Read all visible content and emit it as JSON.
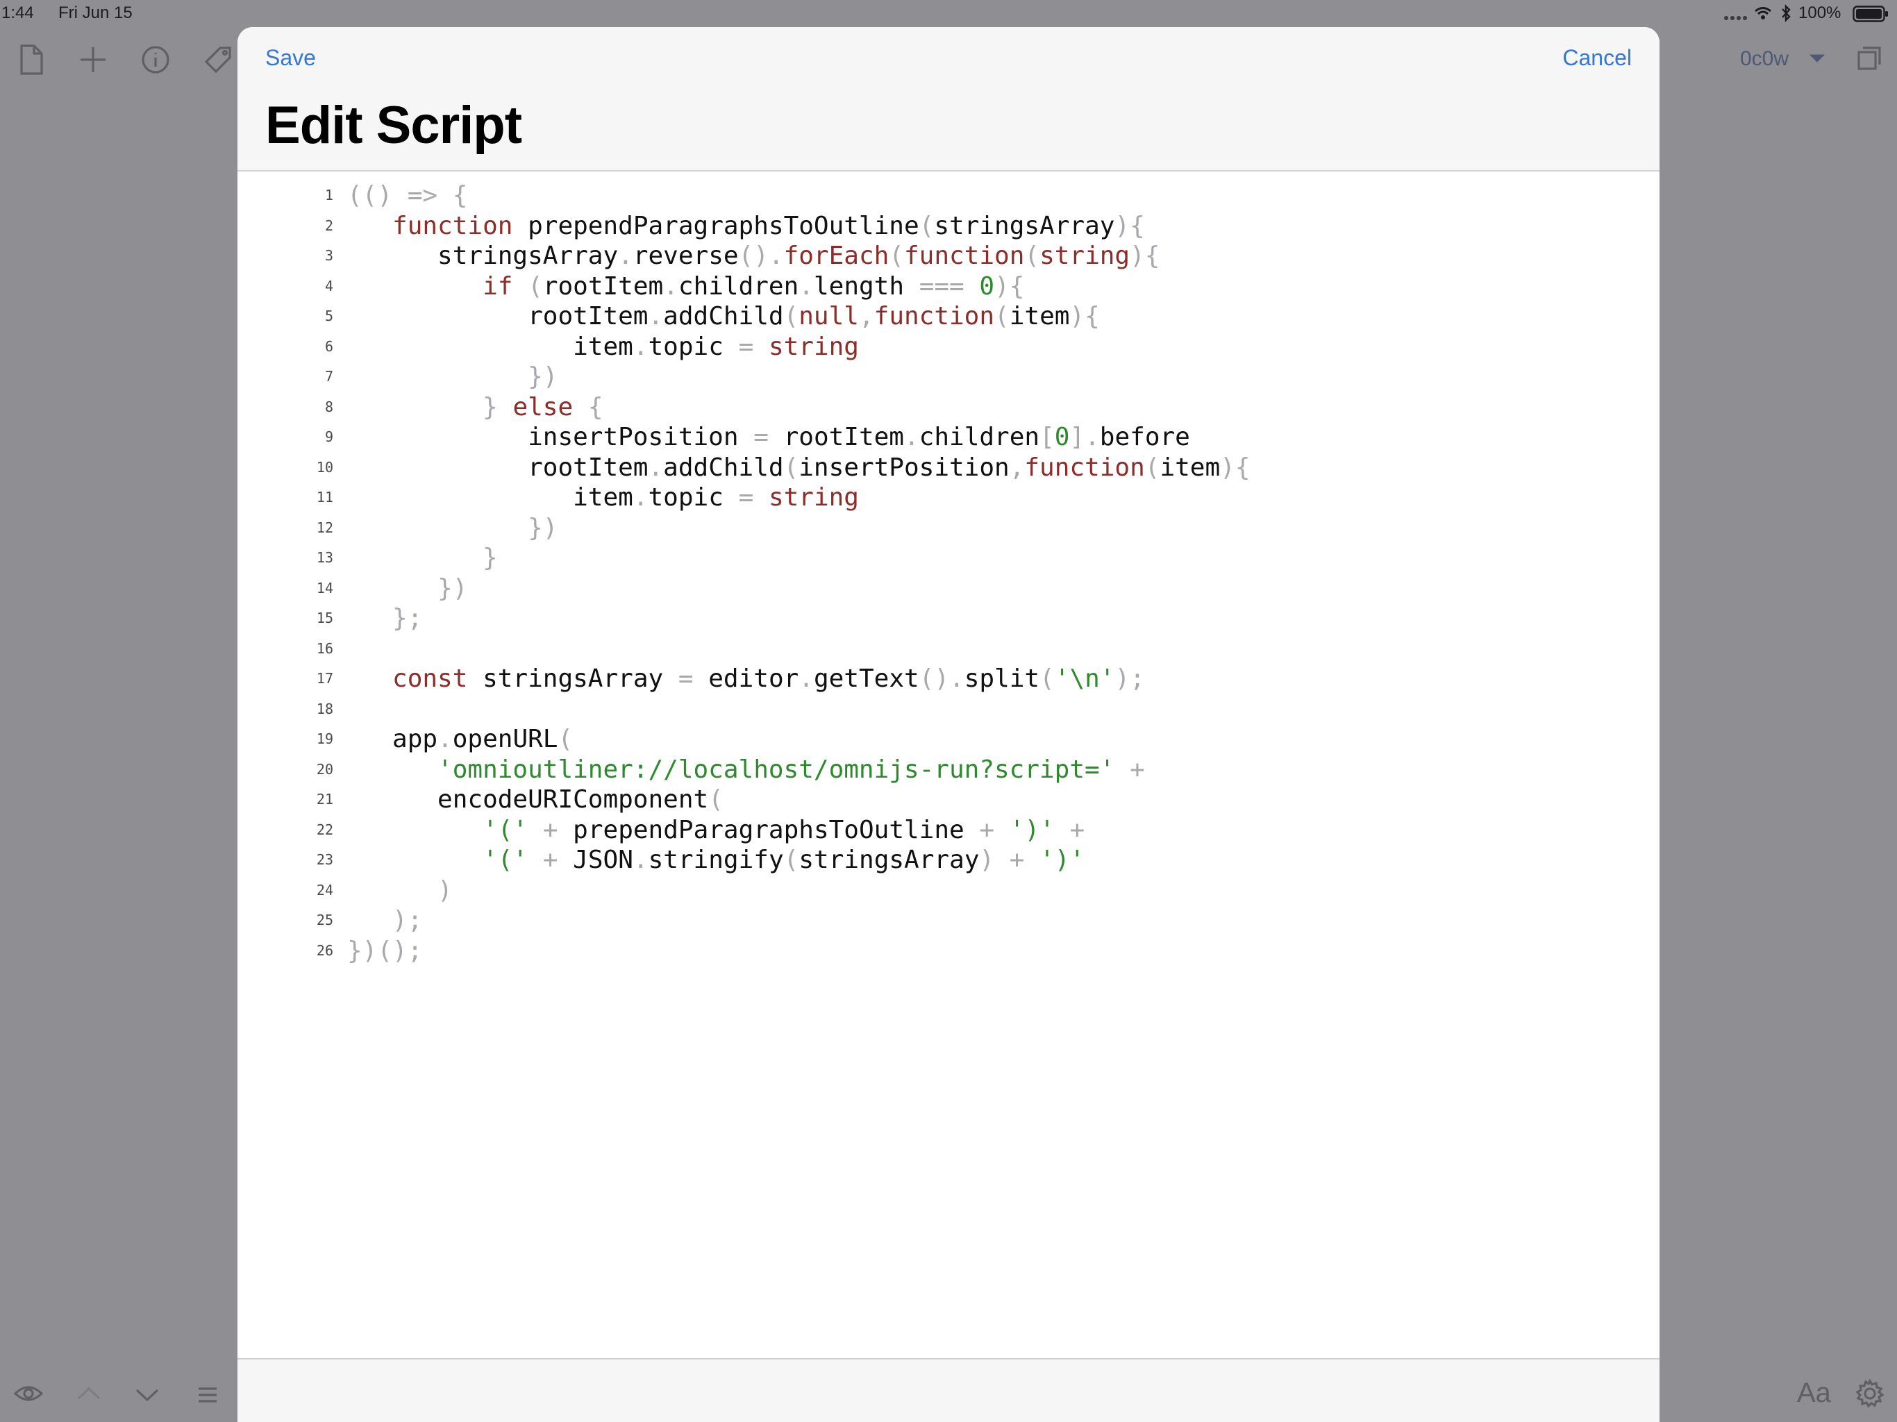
{
  "status_bar": {
    "time": "1:44",
    "date": "Fri Jun 15",
    "battery_percent": "100%",
    "signal_icon": "signal-dots-icon",
    "wifi_icon": "wifi-icon",
    "bluetooth_icon": "bluetooth-icon",
    "battery_icon": "battery-icon"
  },
  "background_toolbar": {
    "document_label": "0c0w",
    "icons": [
      "document-icon",
      "plus-icon",
      "info-icon",
      "tag-icon",
      "chevron-down-icon",
      "duplicate-icon"
    ]
  },
  "background_bottom_toolbar": {
    "font_label": "Aa",
    "icons": [
      "eye-icon",
      "chevron-up-icon",
      "chevron-down-icon",
      "list-icon",
      "gear-icon"
    ]
  },
  "modal": {
    "save_label": "Save",
    "cancel_label": "Cancel",
    "title": "Edit Script",
    "accent_color": "#3478d6"
  },
  "code": {
    "line_numbers": [
      "1",
      "2",
      "3",
      "4",
      "5",
      "6",
      "7",
      "8",
      "9",
      "10",
      "11",
      "12",
      "13",
      "14",
      "15",
      "16",
      "17",
      "18",
      "19",
      "20",
      "21",
      "22",
      "23",
      "24",
      "25",
      "26"
    ],
    "lines": [
      [
        [
          "p",
          "(() => {"
        ]
      ],
      [
        [
          "w",
          "   "
        ],
        [
          "k",
          "function"
        ],
        [
          "w",
          " "
        ],
        [
          "i",
          "prependParagraphsToOutline"
        ],
        [
          "p",
          "("
        ],
        [
          "i",
          "stringsArray"
        ],
        [
          "p",
          "){"
        ]
      ],
      [
        [
          "w",
          "      "
        ],
        [
          "i",
          "stringsArray"
        ],
        [
          "p",
          "."
        ],
        [
          "i",
          "reverse"
        ],
        [
          "p",
          "()."
        ],
        [
          "k",
          "forEach"
        ],
        [
          "p",
          "("
        ],
        [
          "k",
          "function"
        ],
        [
          "p",
          "("
        ],
        [
          "k",
          "string"
        ],
        [
          "p",
          "){"
        ]
      ],
      [
        [
          "w",
          "         "
        ],
        [
          "k",
          "if"
        ],
        [
          "w",
          " "
        ],
        [
          "p",
          "("
        ],
        [
          "i",
          "rootItem"
        ],
        [
          "p",
          "."
        ],
        [
          "i",
          "children"
        ],
        [
          "p",
          "."
        ],
        [
          "i",
          "length"
        ],
        [
          "w",
          " "
        ],
        [
          "p",
          "==="
        ],
        [
          "w",
          " "
        ],
        [
          "n",
          "0"
        ],
        [
          "p",
          "){"
        ]
      ],
      [
        [
          "w",
          "            "
        ],
        [
          "i",
          "rootItem"
        ],
        [
          "p",
          "."
        ],
        [
          "i",
          "addChild"
        ],
        [
          "p",
          "("
        ],
        [
          "k",
          "null"
        ],
        [
          "p",
          ","
        ],
        [
          "k",
          "function"
        ],
        [
          "p",
          "("
        ],
        [
          "i",
          "item"
        ],
        [
          "p",
          "){"
        ]
      ],
      [
        [
          "w",
          "               "
        ],
        [
          "i",
          "item"
        ],
        [
          "p",
          "."
        ],
        [
          "i",
          "topic"
        ],
        [
          "w",
          " "
        ],
        [
          "p",
          "="
        ],
        [
          "w",
          " "
        ],
        [
          "k",
          "string"
        ]
      ],
      [
        [
          "w",
          "            "
        ],
        [
          "p",
          "})"
        ]
      ],
      [
        [
          "w",
          "         "
        ],
        [
          "p",
          "}"
        ],
        [
          "w",
          " "
        ],
        [
          "k",
          "else"
        ],
        [
          "w",
          " "
        ],
        [
          "p",
          "{"
        ]
      ],
      [
        [
          "w",
          "            "
        ],
        [
          "i",
          "insertPosition"
        ],
        [
          "w",
          " "
        ],
        [
          "p",
          "="
        ],
        [
          "w",
          " "
        ],
        [
          "i",
          "rootItem"
        ],
        [
          "p",
          "."
        ],
        [
          "i",
          "children"
        ],
        [
          "p",
          "["
        ],
        [
          "n",
          "0"
        ],
        [
          "p",
          "]."
        ],
        [
          "i",
          "before"
        ]
      ],
      [
        [
          "w",
          "            "
        ],
        [
          "i",
          "rootItem"
        ],
        [
          "p",
          "."
        ],
        [
          "i",
          "addChild"
        ],
        [
          "p",
          "("
        ],
        [
          "i",
          "insertPosition"
        ],
        [
          "p",
          ","
        ],
        [
          "k",
          "function"
        ],
        [
          "p",
          "("
        ],
        [
          "i",
          "item"
        ],
        [
          "p",
          "){"
        ]
      ],
      [
        [
          "w",
          "               "
        ],
        [
          "i",
          "item"
        ],
        [
          "p",
          "."
        ],
        [
          "i",
          "topic"
        ],
        [
          "w",
          " "
        ],
        [
          "p",
          "="
        ],
        [
          "w",
          " "
        ],
        [
          "k",
          "string"
        ]
      ],
      [
        [
          "w",
          "            "
        ],
        [
          "p",
          "})"
        ]
      ],
      [
        [
          "w",
          "         "
        ],
        [
          "p",
          "}"
        ]
      ],
      [
        [
          "w",
          "      "
        ],
        [
          "p",
          "})"
        ]
      ],
      [
        [
          "w",
          "   "
        ],
        [
          "p",
          "};"
        ]
      ],
      [],
      [
        [
          "w",
          "   "
        ],
        [
          "k",
          "const"
        ],
        [
          "w",
          " "
        ],
        [
          "i",
          "stringsArray"
        ],
        [
          "w",
          " "
        ],
        [
          "p",
          "="
        ],
        [
          "w",
          " "
        ],
        [
          "i",
          "editor"
        ],
        [
          "p",
          "."
        ],
        [
          "i",
          "getText"
        ],
        [
          "p",
          "()."
        ],
        [
          "i",
          "split"
        ],
        [
          "p",
          "("
        ],
        [
          "s",
          "'\\n'"
        ],
        [
          "p",
          ");"
        ]
      ],
      [],
      [
        [
          "w",
          "   "
        ],
        [
          "i",
          "app"
        ],
        [
          "p",
          "."
        ],
        [
          "i",
          "openURL"
        ],
        [
          "p",
          "("
        ]
      ],
      [
        [
          "w",
          "      "
        ],
        [
          "s",
          "'omnioutliner://localhost/omnijs-run?script='"
        ],
        [
          "w",
          " "
        ],
        [
          "p",
          "+"
        ]
      ],
      [
        [
          "w",
          "      "
        ],
        [
          "i",
          "encodeURIComponent"
        ],
        [
          "p",
          "("
        ]
      ],
      [
        [
          "w",
          "         "
        ],
        [
          "s",
          "'('"
        ],
        [
          "w",
          " "
        ],
        [
          "p",
          "+"
        ],
        [
          "w",
          " "
        ],
        [
          "i",
          "prependParagraphsToOutline"
        ],
        [
          "w",
          " "
        ],
        [
          "p",
          "+"
        ],
        [
          "w",
          " "
        ],
        [
          "s",
          "')'"
        ],
        [
          "w",
          " "
        ],
        [
          "p",
          "+"
        ]
      ],
      [
        [
          "w",
          "         "
        ],
        [
          "s",
          "'('"
        ],
        [
          "w",
          " "
        ],
        [
          "p",
          "+"
        ],
        [
          "w",
          " "
        ],
        [
          "i",
          "JSON"
        ],
        [
          "p",
          "."
        ],
        [
          "i",
          "stringify"
        ],
        [
          "p",
          "("
        ],
        [
          "i",
          "stringsArray"
        ],
        [
          "p",
          ")"
        ],
        [
          "w",
          " "
        ],
        [
          "p",
          "+"
        ],
        [
          "w",
          " "
        ],
        [
          "s",
          "')'"
        ]
      ],
      [
        [
          "w",
          "      "
        ],
        [
          "p",
          ")"
        ]
      ],
      [
        [
          "w",
          "   "
        ],
        [
          "p",
          ");"
        ]
      ],
      [
        [
          "p",
          "})();"
        ]
      ]
    ]
  }
}
